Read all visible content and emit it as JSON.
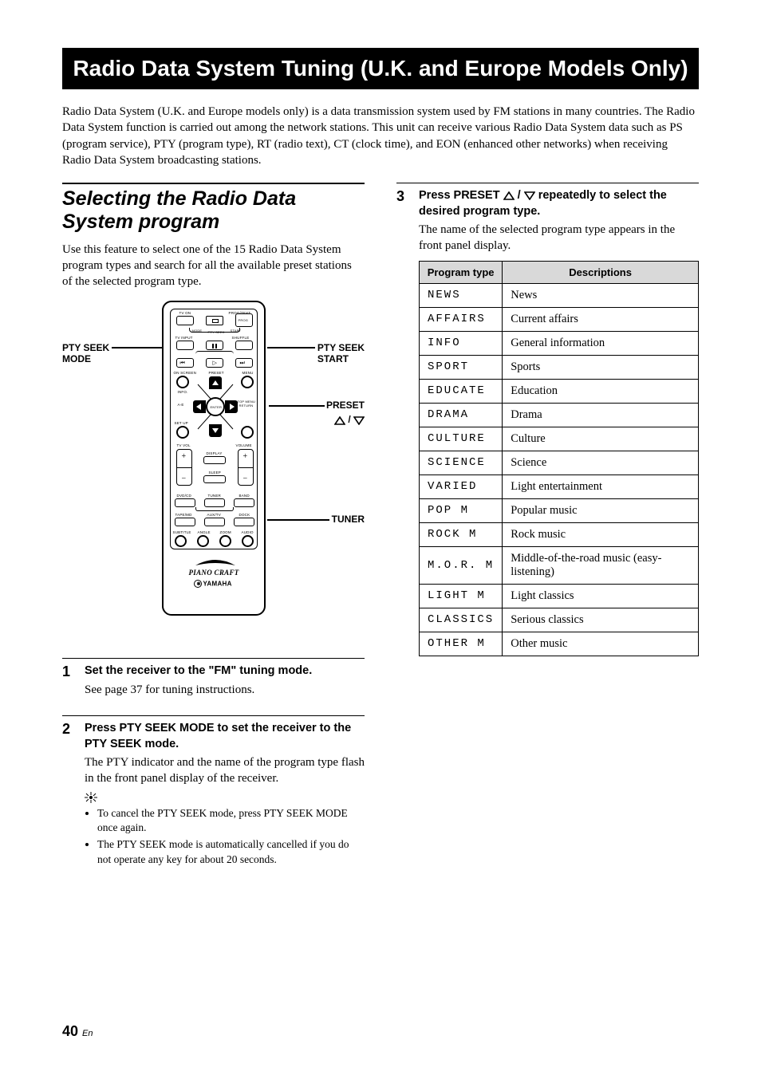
{
  "title": "Radio Data System Tuning (U.K. and Europe Models Only)",
  "intro": "Radio Data System (U.K. and Europe models only) is a data transmission system used by FM stations in many countries. The Radio Data System function is carried out among the network stations. This unit can receive various Radio Data System data such as PS (program service), PTY (program type), RT (radio text), CT (clock time), and EON (enhanced other networks) when receiving Radio Data System broadcasting stations.",
  "section": {
    "heading": "Selecting the Radio Data System program",
    "lead": "Use this feature to select one of the 15 Radio Data System program types and search for all the available preset stations of the selected program type."
  },
  "remote_labels": {
    "pty_seek_mode": "PTY SEEK\nMODE",
    "pty_seek_start": "PTY SEEK\nSTART",
    "preset": "PRESET",
    "tuner": "TUNER",
    "preset_tri_sep": " / "
  },
  "remote_tiny": {
    "tv_on": "TV ON",
    "prog_text": "PROG/TEXT",
    "prog": "PROG",
    "mode": "MODE",
    "pty_seek": "PTY SEEK",
    "start": "START",
    "tv_input": "TV INPUT",
    "shuffle": "SHUFFLE",
    "on_screen": "ON SCREEN",
    "preset": "PRESET",
    "menu": "MENU",
    "info": "INFO.",
    "ae": "A-E",
    "enter": "ENTER",
    "top_menu": "TOP MENU",
    "return": "RETURN",
    "setup": "SET UP",
    "tv_vol": "TV VOL",
    "volume": "VOLUME",
    "display": "DISPLAY",
    "sleep": "SLEEP",
    "dvdcd": "DVD/CD",
    "tuner": "TUNER",
    "band": "BAND",
    "tapemd": "TAPE/MD",
    "auxtv": "AUX/TV",
    "dock": "DOCK",
    "subtitle": "SUBTITLE",
    "angle": "ANGLE",
    "zoom": "ZOOM",
    "audio": "AUDIO"
  },
  "brand": {
    "piano": "PIANO CRAFT",
    "yamaha": "YAMAHA"
  },
  "steps": [
    {
      "num": "1",
      "title": "Set the receiver to the \"FM\" tuning mode.",
      "text": "See page 37 for tuning instructions."
    },
    {
      "num": "2",
      "title": "Press PTY SEEK MODE to set the receiver to the PTY SEEK mode.",
      "text": "The PTY indicator and the name of the program type flash in the front panel display of the receiver.",
      "bullets": [
        "To cancel the PTY SEEK mode, press PTY SEEK MODE once again.",
        "The PTY SEEK mode is automatically cancelled if you do not operate any key for about 20 seconds."
      ]
    },
    {
      "num": "3",
      "title_before": "Press PRESET ",
      "title_mid": " / ",
      "title_after": " repeatedly to select the desired program type.",
      "text": "The name of the selected program type appears in the front panel display."
    }
  ],
  "table": {
    "headers": [
      "Program type",
      "Descriptions"
    ],
    "rows": [
      [
        "NEWS",
        "News"
      ],
      [
        "AFFAIRS",
        "Current affairs"
      ],
      [
        "INFO",
        "General information"
      ],
      [
        "SPORT",
        "Sports"
      ],
      [
        "EDUCATE",
        "Education"
      ],
      [
        "DRAMA",
        "Drama"
      ],
      [
        "CULTURE",
        "Culture"
      ],
      [
        "SCIENCE",
        "Science"
      ],
      [
        "VARIED",
        "Light entertainment"
      ],
      [
        "POP M",
        "Popular music"
      ],
      [
        "ROCK M",
        "Rock music"
      ],
      [
        "M.O.R. M",
        "Middle-of-the-road music (easy-listening)"
      ],
      [
        "LIGHT M",
        "Light classics"
      ],
      [
        "CLASSICS",
        "Serious classics"
      ],
      [
        "OTHER M",
        "Other music"
      ]
    ]
  },
  "page": {
    "num": "40",
    "lang": "En"
  }
}
